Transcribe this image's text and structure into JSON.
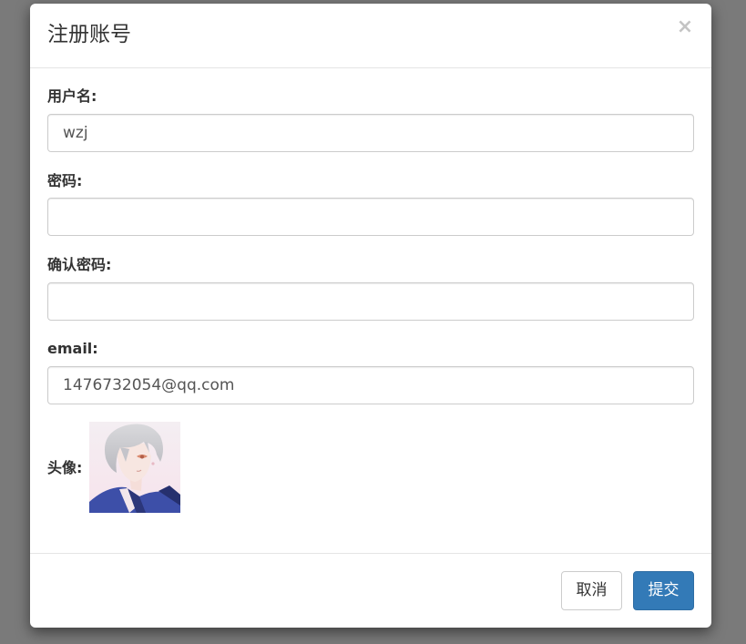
{
  "dialog": {
    "title": "注册账号",
    "close_symbol": "×"
  },
  "form": {
    "username": {
      "label": "用户名:",
      "value": "wzj"
    },
    "password": {
      "label": "密码:",
      "value": ""
    },
    "confirm_password": {
      "label": "确认密码:",
      "value": ""
    },
    "email": {
      "label": "email:",
      "value": "1476732054@qq.com"
    },
    "avatar": {
      "label": "头像:",
      "icon": "anime-avatar-image"
    }
  },
  "footer": {
    "cancel_label": "取消",
    "submit_label": "提交"
  },
  "colors": {
    "backdrop": "#7a7a7a",
    "primary": "#337ab7",
    "close_icon": "#c4c4c4"
  }
}
